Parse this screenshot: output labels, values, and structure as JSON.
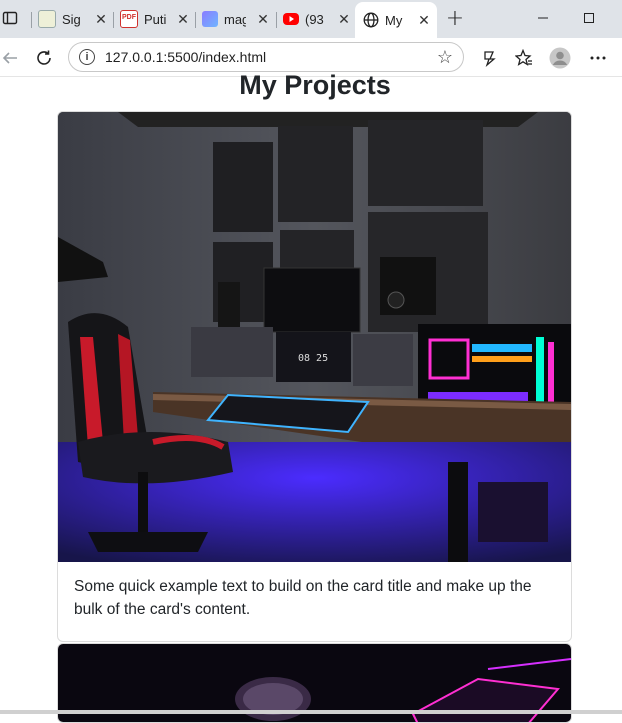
{
  "browser": {
    "tabs": [
      {
        "title": "Sig",
        "icon": "sign-icon"
      },
      {
        "title": "Puti",
        "icon": "pdf-icon"
      },
      {
        "title": "mag",
        "icon": "magic-icon"
      },
      {
        "title": "(93",
        "icon": "youtube-icon"
      },
      {
        "title": "My",
        "icon": "globe-icon"
      }
    ],
    "new_tab_label": "+",
    "url": "127.0.0.1:5500/index.html"
  },
  "page": {
    "title": "My Projects",
    "cards": [
      {
        "text": "Some quick example text to build on the card title and make up the bulk of the card's content."
      }
    ]
  },
  "colors": {
    "tab_strip": "#dfe3e8",
    "text": "#212529",
    "led_blue": "#3a2cff",
    "led_red": "#d11a2a",
    "neon_magenta": "#ff2fd2"
  }
}
